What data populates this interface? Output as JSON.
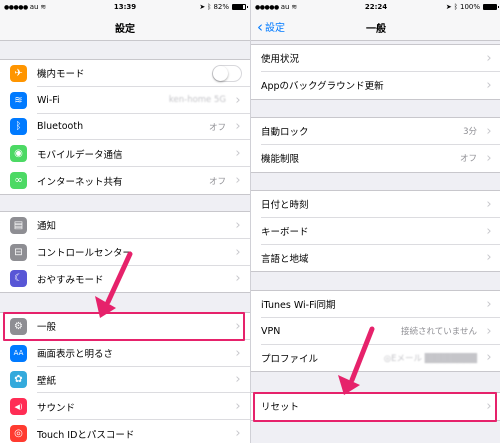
{
  "colors": {
    "accent": "#007aff",
    "highlight": "#e6226b",
    "chevron": "#c7c7cc",
    "secondary_text": "#8e8e93"
  },
  "left": {
    "status": {
      "carrier": "au",
      "time": "13:39",
      "battery": "82%",
      "battery_level": 0.82
    },
    "nav": {
      "title": "設定"
    },
    "groups": [
      [
        {
          "label": "機内モード",
          "icon": "airplane-icon",
          "color": "#ff9500",
          "glyph": "✈",
          "control": "toggle",
          "toggle_on": false
        },
        {
          "label": "Wi-Fi",
          "icon": "wifi-icon",
          "color": "#007aff",
          "glyph": "≋",
          "value": "ken-home 5G",
          "value_blurred": true
        },
        {
          "label": "Bluetooth",
          "icon": "bluetooth-icon",
          "color": "#007aff",
          "glyph": "ᛒ",
          "value": "オフ"
        },
        {
          "label": "モバイルデータ通信",
          "icon": "antenna-icon",
          "color": "#4cd964",
          "glyph": "◉"
        },
        {
          "label": "インターネット共有",
          "icon": "link-icon",
          "color": "#4cd964",
          "glyph": "∞",
          "value": "オフ"
        }
      ],
      [
        {
          "label": "通知",
          "icon": "notifications-icon",
          "color": "#8e8e93",
          "glyph": "▤"
        },
        {
          "label": "コントロールセンター",
          "icon": "control-center-icon",
          "color": "#8e8e93",
          "glyph": "⊟"
        },
        {
          "label": "おやすみモード",
          "icon": "moon-icon",
          "color": "#5856d6",
          "glyph": "☾"
        }
      ],
      [
        {
          "label": "一般",
          "icon": "gear-icon",
          "color": "#8e8e93",
          "glyph": "⚙"
        },
        {
          "label": "画面表示と明るさ",
          "icon": "display-icon",
          "color": "#007aff",
          "glyph": "AA"
        },
        {
          "label": "壁紙",
          "icon": "wallpaper-icon",
          "color": "#34aadc",
          "glyph": "✿"
        },
        {
          "label": "サウンド",
          "icon": "sound-icon",
          "color": "#ff2d55",
          "glyph": "◀)"
        },
        {
          "label": "Touch IDとパスコード",
          "icon": "fingerprint-icon",
          "color": "#ff3b30",
          "glyph": "◎"
        }
      ]
    ]
  },
  "right": {
    "status": {
      "carrier": "au",
      "time": "22:24",
      "battery": "100%",
      "battery_level": 1.0
    },
    "nav": {
      "title": "一般",
      "back_label": "設定"
    },
    "groups": [
      [
        {
          "label": "使用状況"
        },
        {
          "label": "Appのバックグラウンド更新"
        }
      ],
      [
        {
          "label": "自動ロック",
          "value": "3分"
        },
        {
          "label": "機能制限",
          "value": "オフ"
        }
      ],
      [
        {
          "label": "日付と時刻"
        },
        {
          "label": "キーボード"
        },
        {
          "label": "言語と地域"
        }
      ],
      [
        {
          "label": "iTunes Wi-Fi同期"
        },
        {
          "label": "VPN",
          "value": "接続されていません"
        },
        {
          "label": "プロファイル",
          "value": "◎Eメール ████████",
          "value_blurred": true
        }
      ],
      [
        {
          "label": "リセット"
        }
      ]
    ]
  }
}
